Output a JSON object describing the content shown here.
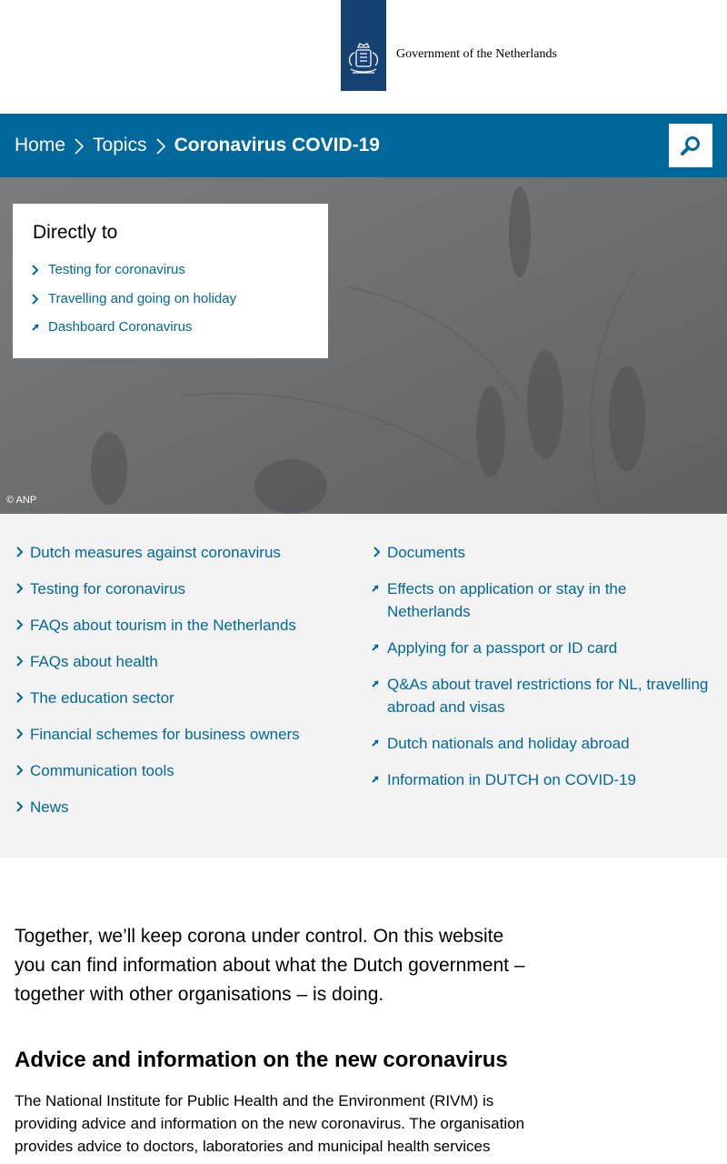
{
  "header": {
    "logo_text": "Government of the Netherlands"
  },
  "nav": {
    "breadcrumbs": [
      "Home",
      "Topics",
      "Coronavirus COVID-19"
    ],
    "search_icon": "search-icon"
  },
  "hero": {
    "credit": "© ANP",
    "directly_to": {
      "title": "Directly to",
      "links": [
        {
          "label": "Testing for coronavirus",
          "icon": "chevron-right-icon"
        },
        {
          "label": "Travelling and going on holiday",
          "icon": "chevron-right-icon"
        },
        {
          "label": "Dashboard Coronavirus",
          "icon": "external-link-icon"
        }
      ]
    }
  },
  "links": {
    "left": [
      {
        "label": "Dutch measures against coronavirus",
        "icon": "chevron-right-icon"
      },
      {
        "label": "Testing for coronavirus",
        "icon": "chevron-right-icon"
      },
      {
        "label": "FAQs about tourism in the Netherlands",
        "icon": "chevron-right-icon"
      },
      {
        "label": "FAQs about health",
        "icon": "chevron-right-icon"
      },
      {
        "label": "The education sector",
        "icon": "chevron-right-icon"
      },
      {
        "label": "Financial schemes for business owners",
        "icon": "chevron-right-icon"
      },
      {
        "label": "Communication tools",
        "icon": "chevron-right-icon"
      },
      {
        "label": "News",
        "icon": "chevron-right-icon"
      }
    ],
    "right": [
      {
        "label": "Documents",
        "icon": "chevron-right-icon"
      },
      {
        "label": "Effects on application or stay in the Netherlands",
        "icon": "external-link-icon"
      },
      {
        "label": "Applying for a passport or ID card",
        "icon": "external-link-icon"
      },
      {
        "label": "Q&As about travel restrictions for NL, travelling abroad and visas",
        "icon": "external-link-icon"
      },
      {
        "label": "Dutch nationals and holiday abroad",
        "icon": "external-link-icon"
      },
      {
        "label": "Information in DUTCH on COVID-19",
        "icon": "external-link-icon"
      }
    ]
  },
  "content": {
    "intro": "Together, we’ll keep corona under control. On this website you can find information about what the Dutch government – together with other organisations – is doing.",
    "heading": "Advice and information on the new coronavirus",
    "paragraph": "The National Institute for Public Health and the Environment (RIVM) is providing advice and information on the new coronavirus. The organisation provides advice to doctors, laboratories and municipal health services"
  },
  "colors": {
    "brand_blue": "#154273",
    "nav_blue": "#01689b",
    "link_blue": "#01689b",
    "section_gray": "#f3f3f3"
  }
}
